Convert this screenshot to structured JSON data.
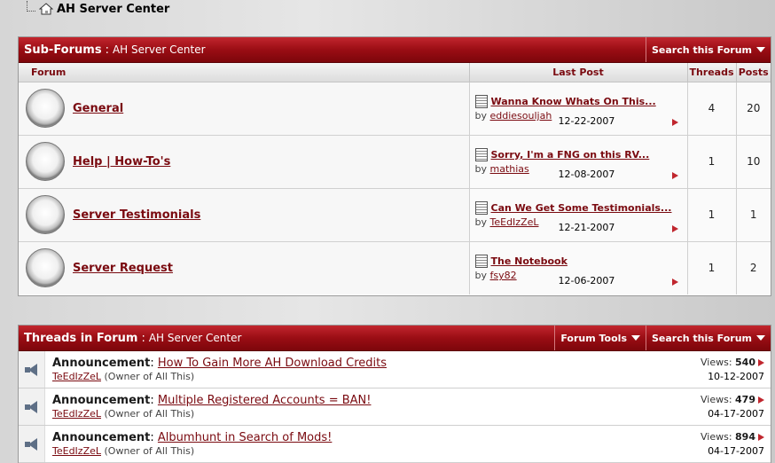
{
  "breadcrumb": {
    "current": "AH Server Center"
  },
  "subforums": {
    "title": "Sub-Forums",
    "separator": ":",
    "forum_name": "AH Server Center",
    "search_label": "Search this Forum",
    "columns": {
      "forum": "Forum",
      "last_post": "Last Post",
      "threads": "Threads",
      "posts": "Posts"
    },
    "rows": [
      {
        "name": "General",
        "last_title": "Wanna Know Whats On This...",
        "by": "by",
        "author": "eddiesouljah",
        "date": "12-22-2007",
        "threads": "4",
        "posts": "20"
      },
      {
        "name": "Help | How-To's",
        "last_title": "Sorry, I'm a FNG on this RV...",
        "by": "by",
        "author": "mathias",
        "date": "12-08-2007",
        "threads": "1",
        "posts": "10"
      },
      {
        "name": "Server Testimonials",
        "last_title": "Can We Get Some Testimonials...",
        "by": "by",
        "author": "TeEdIzZeL",
        "date": "12-21-2007",
        "threads": "1",
        "posts": "1"
      },
      {
        "name": "Server Request",
        "last_title": "The Notebook",
        "by": "by",
        "author": "fsy82",
        "date": "12-06-2007",
        "threads": "1",
        "posts": "2"
      }
    ]
  },
  "threads": {
    "title": "Threads in Forum",
    "separator": ":",
    "forum_name": "AH Server Center",
    "tools_label": "Forum Tools",
    "search_label": "Search this Forum",
    "rows": [
      {
        "prefix": "Announcement",
        "colon": ":",
        "title": "How To Gain More AH Download Credits",
        "author": "TeEdIzZeL",
        "role": "(Owner of All This)",
        "views_label": "Views:",
        "views": "540",
        "date": "10-12-2007"
      },
      {
        "prefix": "Announcement",
        "colon": ":",
        "title": "Multiple Registered Accounts = BAN!",
        "author": "TeEdIzZeL",
        "role": "(Owner of All This)",
        "views_label": "Views:",
        "views": "479",
        "date": "04-17-2007"
      },
      {
        "prefix": "Announcement",
        "colon": ":",
        "title": "Albumhunt in Search of Mods!",
        "author": "TeEdIzZeL",
        "role": "(Owner of All This)",
        "views_label": "Views:",
        "views": "894",
        "date": "04-17-2007"
      }
    ]
  },
  "colors": {
    "header_red": "#9a0d14",
    "link_red": "#7a0a10",
    "arrow_red": "#c0262e"
  },
  "icons": {
    "breadcrumb": "home-icon",
    "forum_status": "forum-status-icon",
    "post": "document-icon",
    "announcement": "announcement-speaker-icon",
    "go": "go-arrow-icon",
    "dropdown": "dropdown-triangle-icon"
  }
}
